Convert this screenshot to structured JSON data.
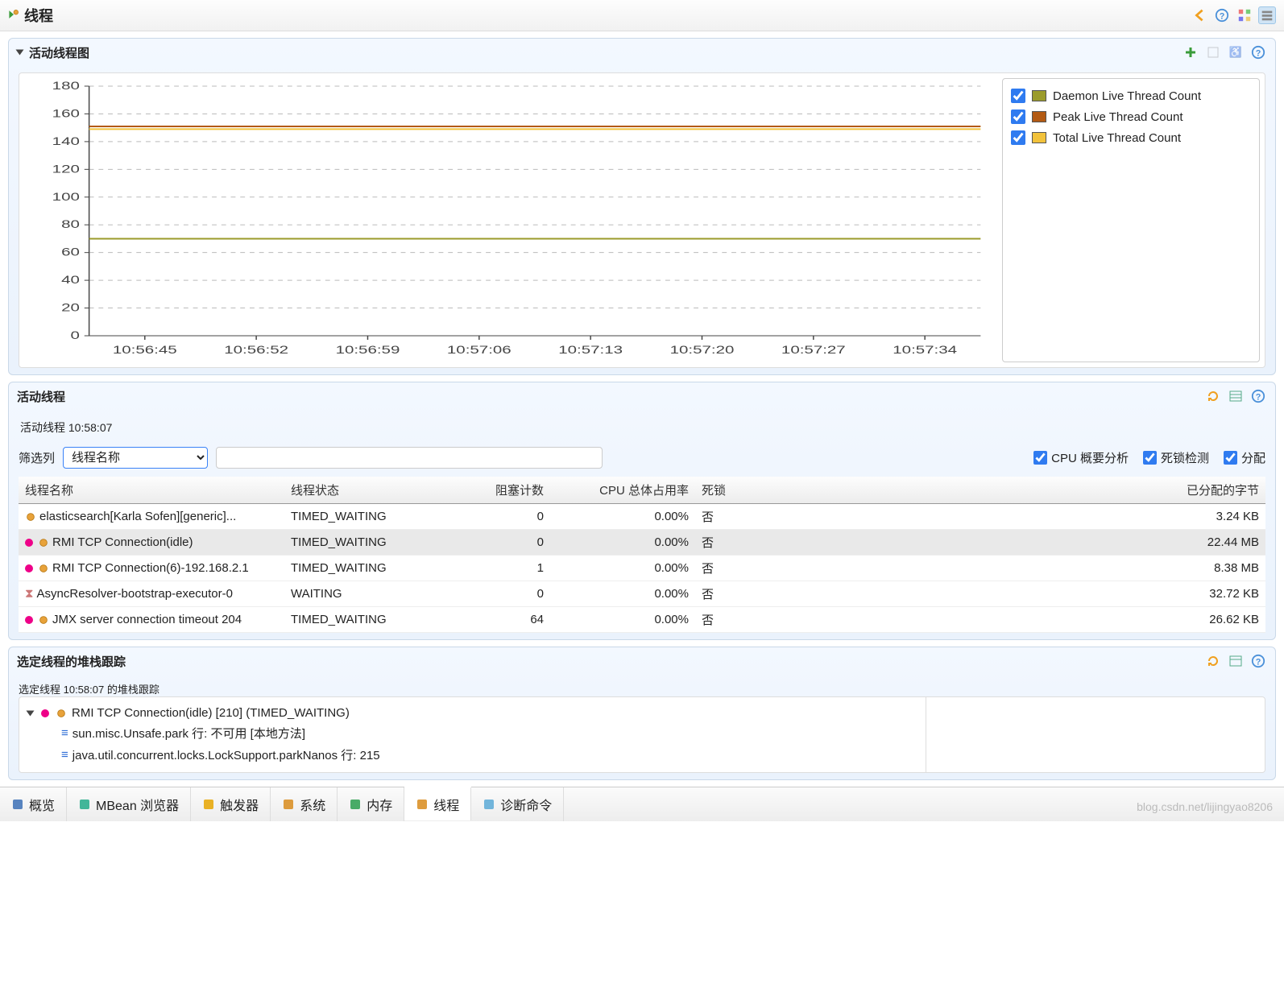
{
  "header": {
    "title": "线程"
  },
  "chartSection": {
    "title": "活动线程图",
    "legend": [
      {
        "label": "Daemon Live Thread Count",
        "color": "#9b9b2b",
        "checked": true
      },
      {
        "label": "Peak Live Thread Count",
        "color": "#b35a13",
        "checked": true
      },
      {
        "label": "Total Live Thread Count",
        "color": "#f2c23b",
        "checked": true
      }
    ]
  },
  "chart_data": {
    "type": "line",
    "title": "",
    "xlabel": "",
    "ylabel": "",
    "ylim": [
      0,
      180
    ],
    "y_ticks": [
      0,
      20,
      40,
      60,
      80,
      100,
      120,
      140,
      160,
      180
    ],
    "categories": [
      "10:56:45",
      "10:56:52",
      "10:56:59",
      "10:57:06",
      "10:57:13",
      "10:57:20",
      "10:57:27",
      "10:57:34"
    ],
    "series": [
      {
        "name": "Daemon Live Thread Count",
        "color": "#9b9b2b",
        "values": [
          70,
          70,
          70,
          70,
          70,
          70,
          70,
          70
        ]
      },
      {
        "name": "Peak Live Thread Count",
        "color": "#b35a13",
        "values": [
          151,
          151,
          151,
          151,
          151,
          151,
          151,
          151
        ]
      },
      {
        "name": "Total Live Thread Count",
        "color": "#f2c23b",
        "values": [
          149,
          149,
          149,
          149,
          149,
          149,
          149,
          149
        ]
      }
    ]
  },
  "threadsSection": {
    "title": "活动线程",
    "timestampLabel": "活动线程 10:58:07",
    "filterLabel": "筛选列",
    "filterSelect": "线程名称",
    "checkbox_cpu": "CPU 概要分析",
    "checkbox_deadlock": "死锁检测",
    "checkbox_alloc": "分配",
    "columns": {
      "name": "线程名称",
      "state": "线程状态",
      "blocked": "阻塞计数",
      "cpu": "CPU 总体占用率",
      "deadlock": "死锁",
      "alloc": "已分配的字节"
    },
    "rows": [
      {
        "icon": "gear",
        "lock": false,
        "name": "elasticsearch[Karla Sofen][generic]...",
        "state": "TIMED_WAITING",
        "blocked": "0",
        "cpu": "0.00%",
        "deadlock": "否",
        "alloc": "3.24 KB",
        "selected": false
      },
      {
        "icon": "gear",
        "lock": true,
        "name": "RMI TCP Connection(idle)",
        "state": "TIMED_WAITING",
        "blocked": "0",
        "cpu": "0.00%",
        "deadlock": "否",
        "alloc": "22.44 MB",
        "selected": true
      },
      {
        "icon": "gear",
        "lock": true,
        "name": "RMI TCP Connection(6)-192.168.2.1",
        "state": "TIMED_WAITING",
        "blocked": "1",
        "cpu": "0.00%",
        "deadlock": "否",
        "alloc": "8.38 MB",
        "selected": false
      },
      {
        "icon": "hourglass",
        "lock": false,
        "name": "AsyncResolver-bootstrap-executor-0",
        "state": "WAITING",
        "blocked": "0",
        "cpu": "0.00%",
        "deadlock": "否",
        "alloc": "32.72 KB",
        "selected": false
      },
      {
        "icon": "gear",
        "lock": true,
        "name": "JMX server connection timeout 204",
        "state": "TIMED_WAITING",
        "blocked": "64",
        "cpu": "0.00%",
        "deadlock": "否",
        "alloc": "26.62 KB",
        "selected": false
      }
    ]
  },
  "stackSection": {
    "title": "选定线程的堆栈跟踪",
    "sub": "选定线程 10:58:07 的堆栈跟踪",
    "root": "RMI TCP Connection(idle) [210] (TIMED_WAITING)",
    "lines": [
      "sun.misc.Unsafe.park 行: 不可用 [本地方法]",
      "java.util.concurrent.locks.LockSupport.parkNanos 行: 215"
    ]
  },
  "tabs": [
    {
      "label": "概览",
      "iconColor": "#3b6fb5"
    },
    {
      "label": "MBean 浏览器",
      "iconColor": "#2a8"
    },
    {
      "label": "触发器",
      "iconColor": "#e6a400"
    },
    {
      "label": "系统",
      "iconColor": "#d88b1c"
    },
    {
      "label": "内存",
      "iconColor": "#2a9d4d"
    },
    {
      "label": "线程",
      "iconColor": "#d88b1c",
      "active": true
    },
    {
      "label": "诊断命令",
      "iconColor": "#5aa9d6"
    }
  ],
  "watermark": "blog.csdn.net/lijingyao8206"
}
